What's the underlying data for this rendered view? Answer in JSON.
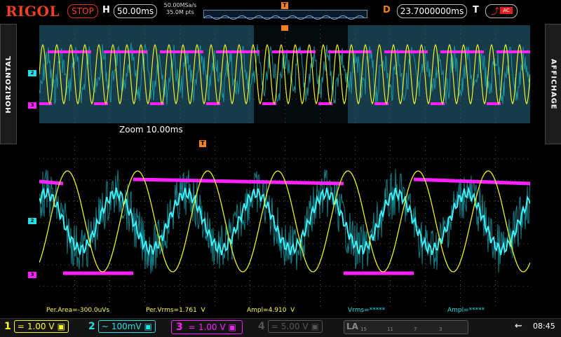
{
  "header": {
    "brand": "RIGOL",
    "run_status": "STOP",
    "timebase_letter": "H",
    "timebase": "50.00ms",
    "sample_rate": "50.00MSa/s",
    "memory_depth": "35.0M pts",
    "delay_letter": "D",
    "delay": "23.7000000ms",
    "trigger_letter": "T",
    "trigger_source": "AC",
    "trigger_marker": "T"
  },
  "side_tabs": {
    "left": "HORIZONTAL",
    "right": "AFFICHAGE"
  },
  "zoom_label": "Zoom  10.00ms",
  "channel_markers": {
    "ch2": "2",
    "ch3": "3"
  },
  "measurements": {
    "per_area": "Per.Area=-300.0uVs",
    "per_vrms": "Per.Vrms=1.761  V",
    "ampl": "Ampl=4.910  V",
    "vrms": "Vrms=*****",
    "ampl2": "Ampl=*****"
  },
  "channels": [
    {
      "num": "1",
      "coupling": "=",
      "scale": "1.00 V",
      "color": "#ffff20"
    },
    {
      "num": "2",
      "coupling": "~",
      "scale": "100mV",
      "color": "#20e0e8"
    },
    {
      "num": "3",
      "coupling": "=",
      "scale": "1.00 V",
      "color": "#ff20ff"
    },
    {
      "num": "4",
      "coupling": "=",
      "scale": "5.00 V",
      "color": "#555555"
    }
  ],
  "logic_analyzer": {
    "label": "LA",
    "ticks": [
      "15",
      "11",
      "7",
      "3"
    ]
  },
  "status": {
    "clock": "08:45",
    "usb_icon": "usb-icon"
  },
  "colors": {
    "ch1": "#f0f020",
    "ch2": "#20e0e8",
    "ch3": "#ff20ff",
    "trigger": "#f08020",
    "brand": "#f04020"
  }
}
